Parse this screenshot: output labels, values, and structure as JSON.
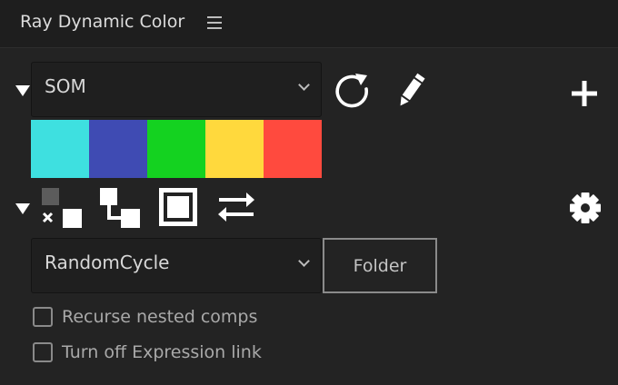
{
  "panel": {
    "title": "Ray Dynamic Color",
    "menu_icon": "hamburger-menu-icon"
  },
  "palette_section": {
    "selected_palette": "SOM",
    "icons": {
      "reset": "refresh-icon",
      "edit": "pencil-icon",
      "add": "plus-icon"
    },
    "swatches": [
      {
        "color": "#3ee0e0"
      },
      {
        "color": "#3f4bb3"
      },
      {
        "color": "#14d220"
      },
      {
        "color": "#ffd93d"
      },
      {
        "color": "#ff4a3e"
      }
    ]
  },
  "mode_section": {
    "icons": {
      "mode_a": "random-squares-icon",
      "mode_b": "hierarchy-squares-icon",
      "mode_c": "framed-square-icon",
      "mode_d": "swap-arrows-icon",
      "settings": "gear-icon"
    },
    "selected_mode": "RandomCycle",
    "folder_label": "Folder"
  },
  "options": [
    {
      "label": "Recurse nested comps",
      "checked": false
    },
    {
      "label": "Turn off Expression link",
      "checked": false
    }
  ]
}
